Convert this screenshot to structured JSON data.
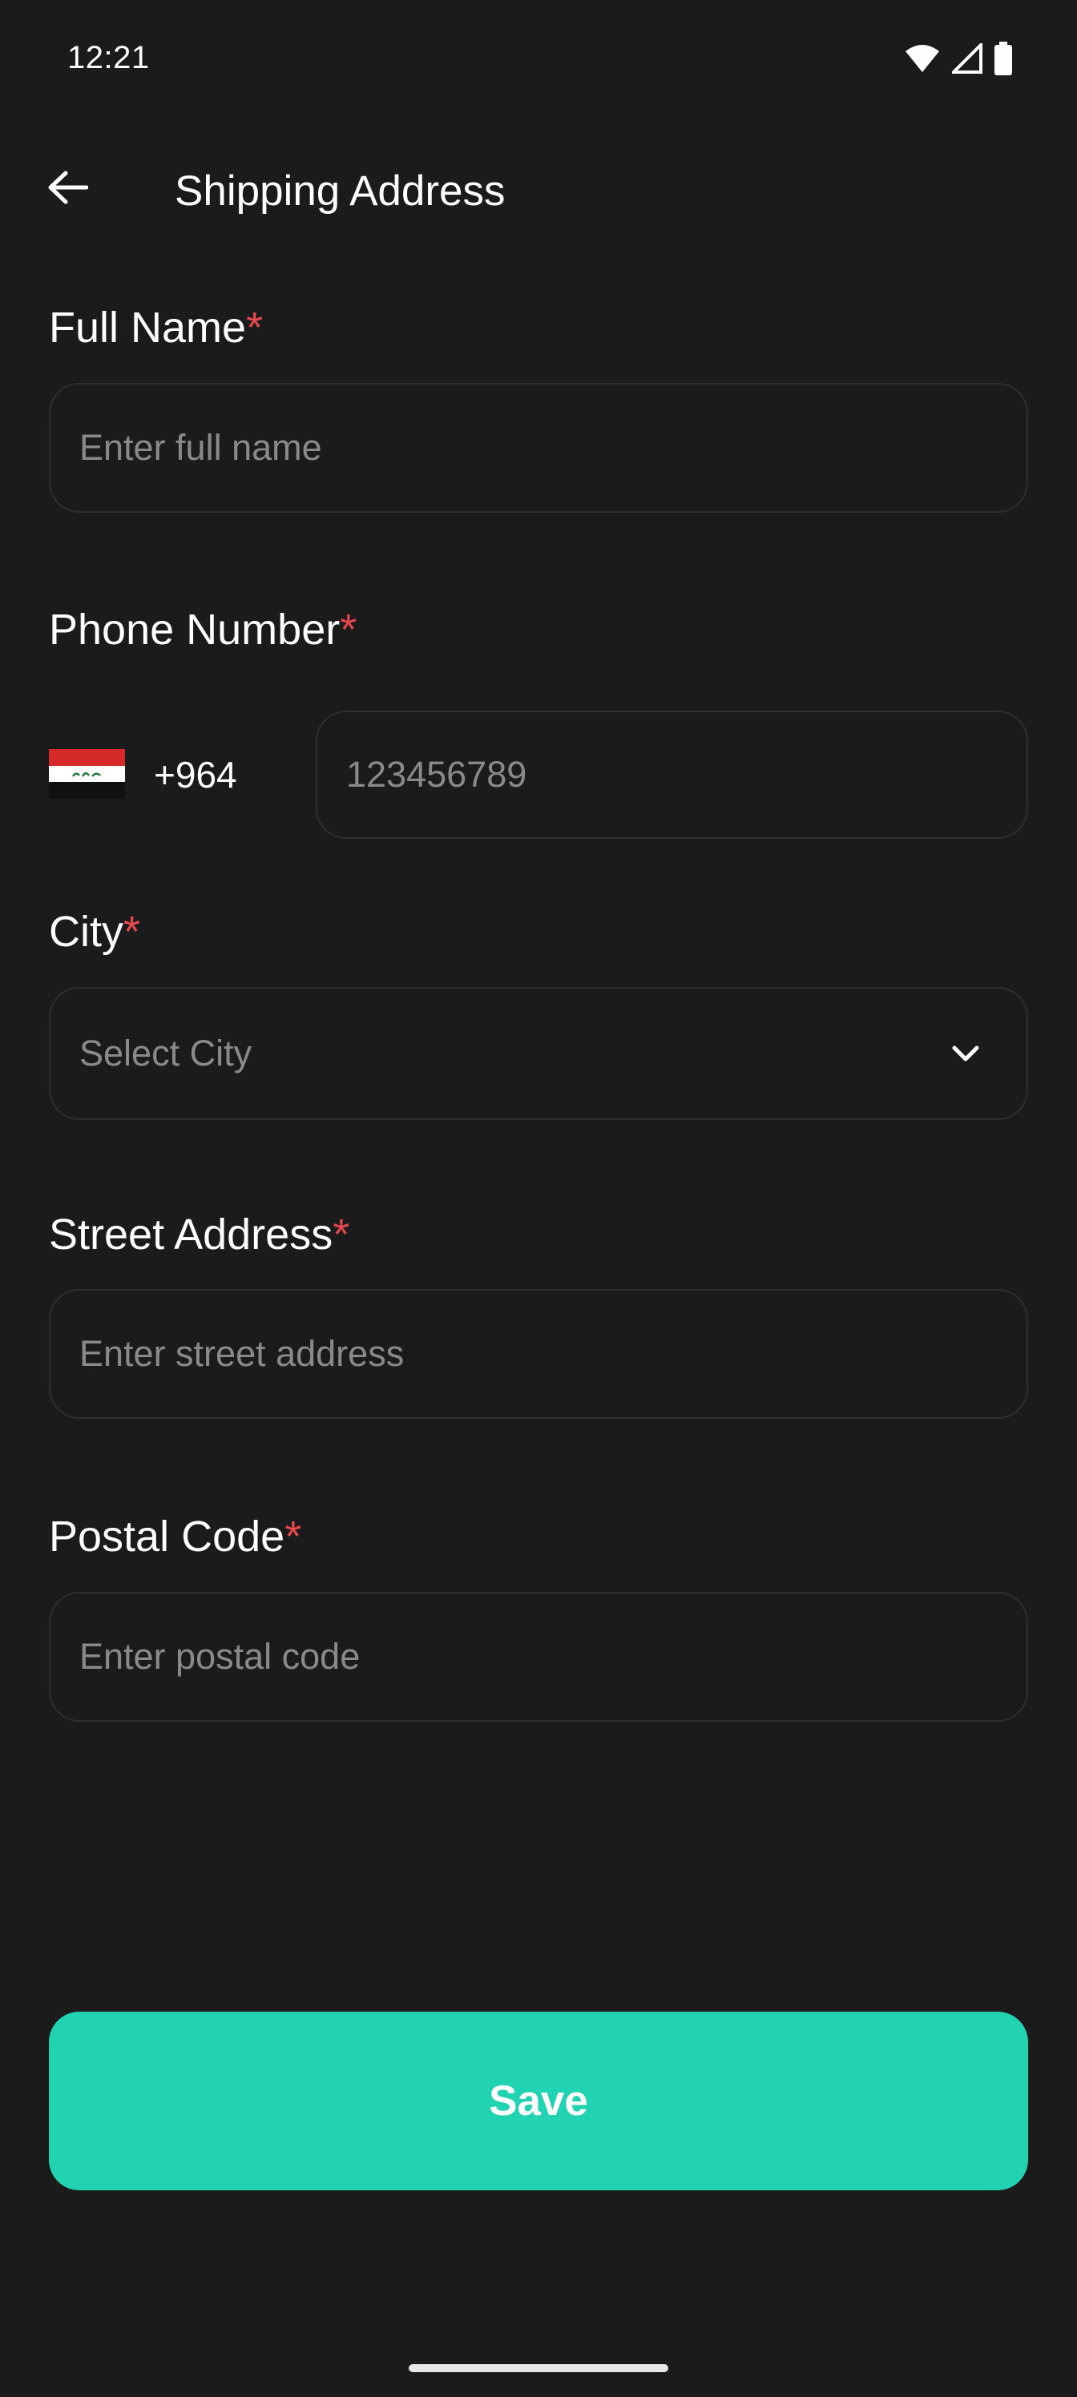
{
  "status_bar": {
    "time": "12:21"
  },
  "header": {
    "title": "Shipping Address",
    "back_icon": "arrow-left-icon"
  },
  "form": {
    "full_name": {
      "label": "Full Name",
      "required_mark": "*",
      "placeholder": "Enter full name",
      "value": ""
    },
    "phone": {
      "label": "Phone Number",
      "required_mark": "*",
      "country_flag": "iraq-flag-icon",
      "dial_code": "+964",
      "placeholder": "123456789",
      "value": ""
    },
    "city": {
      "label": "City",
      "required_mark": "*",
      "placeholder": "Select City",
      "value": ""
    },
    "street": {
      "label": "Street Address",
      "required_mark": "*",
      "placeholder": "Enter street address",
      "value": ""
    },
    "postal": {
      "label": "Postal Code",
      "required_mark": "*",
      "placeholder": "Enter postal code",
      "value": ""
    }
  },
  "actions": {
    "save_label": "Save"
  },
  "colors": {
    "background": "#1b1b1b",
    "accent": "#22d3b2",
    "required": "#e5484d",
    "field_border": "#2f2f2f",
    "placeholder": "#8a8a8a"
  }
}
